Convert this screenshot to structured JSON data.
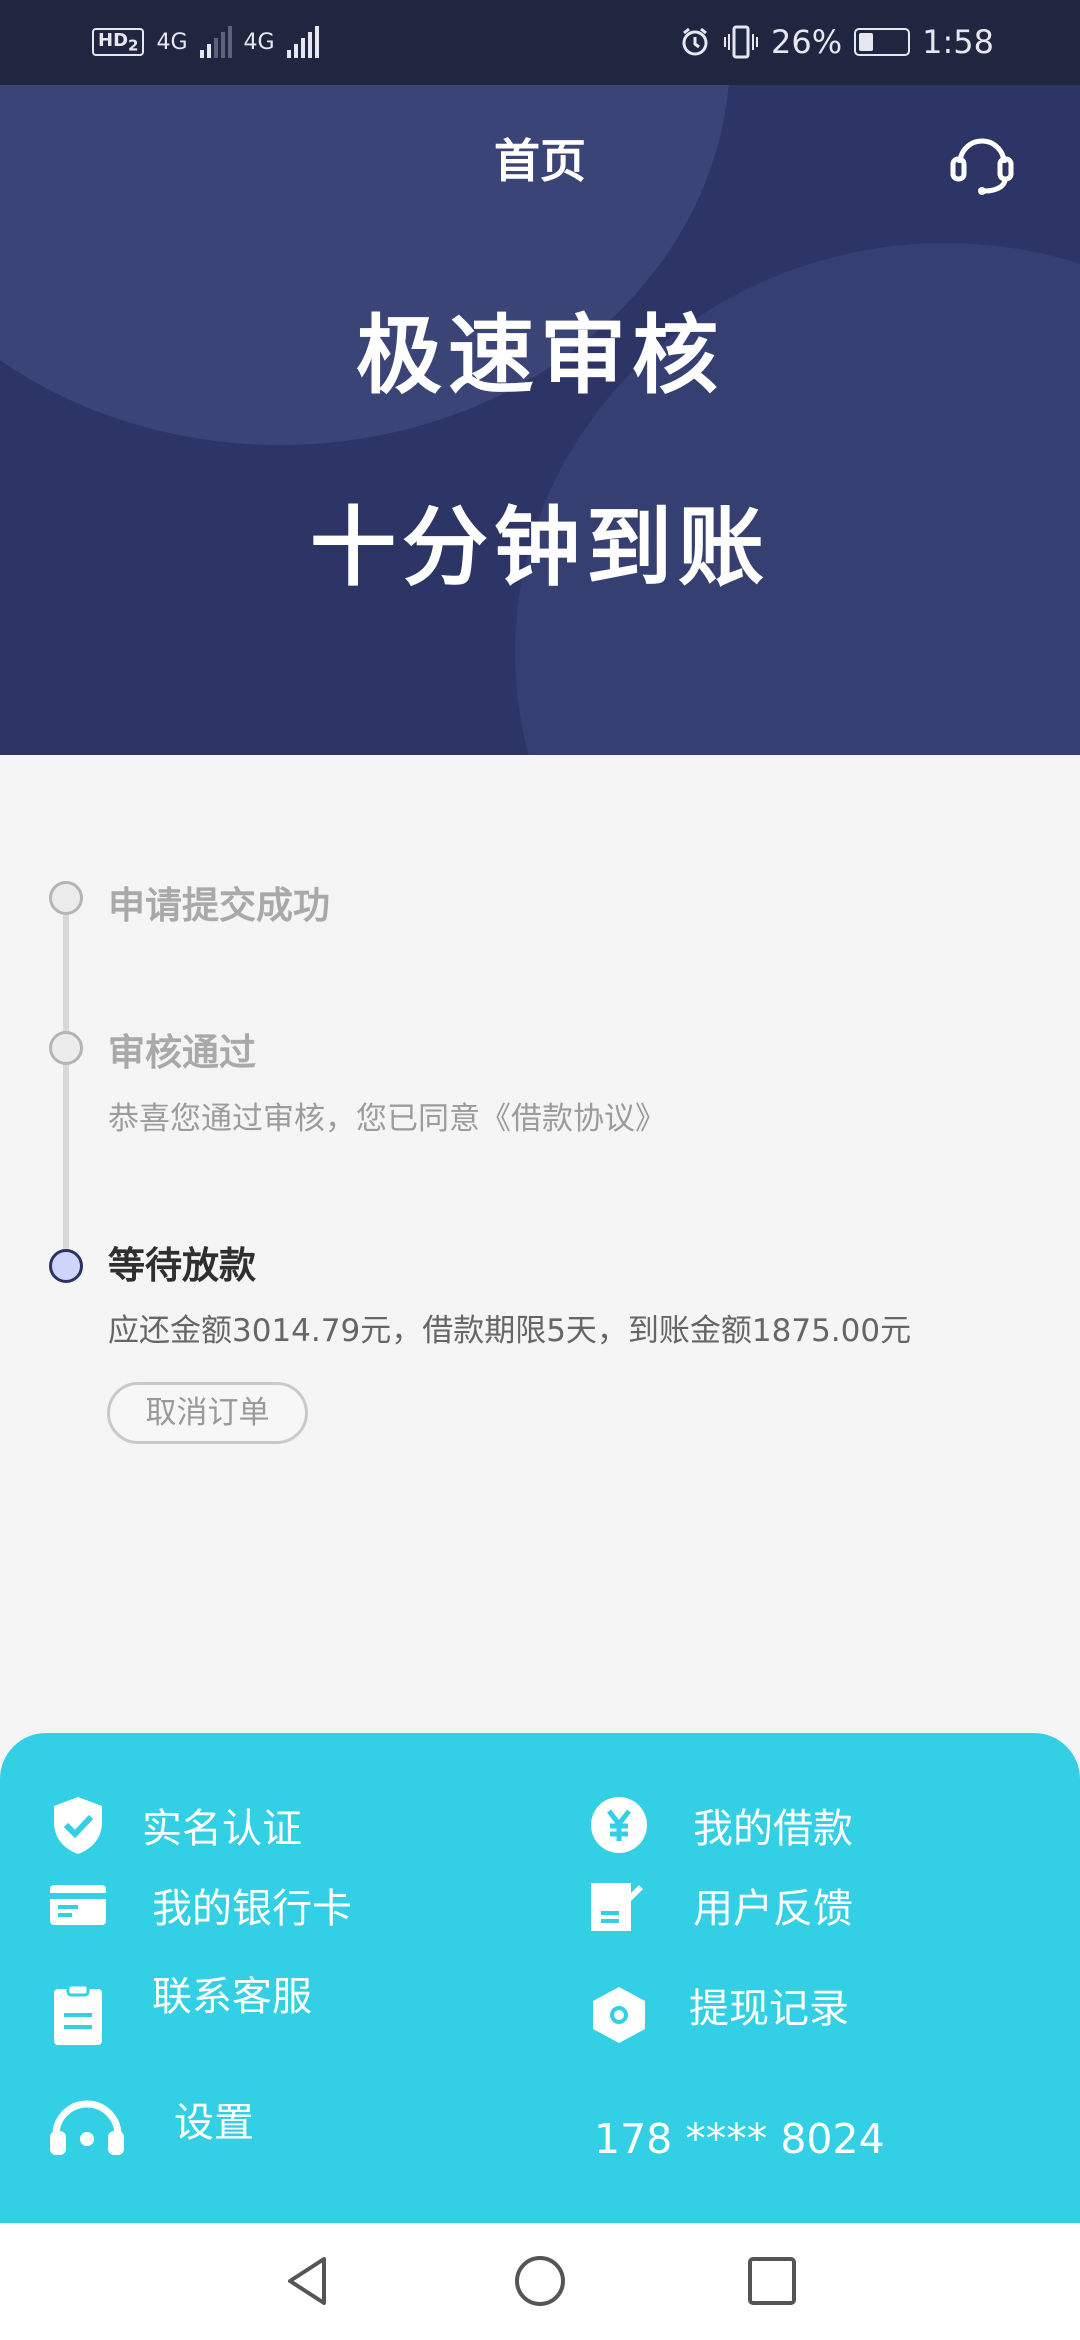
{
  "status_bar": {
    "hd_label": "HD",
    "hd_sub": "2",
    "net1": "4G",
    "net2": "4G",
    "battery": "26%",
    "time": "1:58"
  },
  "header": {
    "title": "首页",
    "support_icon": "headset-icon"
  },
  "banner": {
    "line1": "极速审核",
    "line2": "十分钟到账"
  },
  "timeline": [
    {
      "title": "申请提交成功",
      "desc": ""
    },
    {
      "title": "审核通过",
      "desc": "恭喜您通过审核，您已同意《借款协议》"
    },
    {
      "title": "等待放款",
      "desc": "应还金额3014.79元，借款期限5天，到账金额1875.00元"
    }
  ],
  "cancel_label": "取消订单",
  "menu": {
    "verify": "实名认证",
    "loans": "我的借款",
    "bank_card": "我的银行卡",
    "feedback": "用户反馈",
    "contact": "联系客服",
    "withdraw_records": "提现记录",
    "settings": "设置",
    "phone": "178 **** 8024"
  },
  "colors": {
    "hero": "#2c3566",
    "menu": "#33d0e5",
    "status_bar": "#20263f"
  }
}
